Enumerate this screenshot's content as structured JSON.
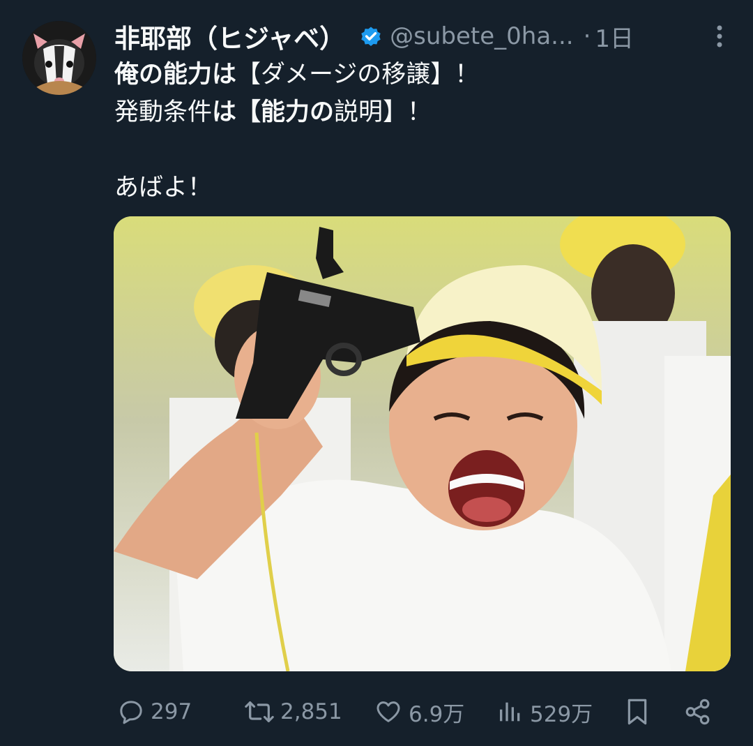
{
  "author": {
    "name": "非耶部（ヒジャベ）",
    "handle": "@subete_0ha...",
    "separator": "·",
    "time": "1日",
    "verified_color": "#1d9bf0"
  },
  "tweet": {
    "line1": {
      "bold_prefix": "俺の能力は",
      "rest": "【ダメージの移譲】！"
    },
    "line2": {
      "normal_1": "発動条件",
      "bold_1": "は【能力の",
      "normal_2": "説明",
      "rest": "】！"
    },
    "line3": "",
    "line4": "あばよ！"
  },
  "media": {
    "alt": "photo of a laughing child in a yellow cap pointing a starter pistol at his head"
  },
  "actions": {
    "replies": "297",
    "retweets": "2,851",
    "likes": "6.9万",
    "views": "529万"
  },
  "icons": {
    "reply": "reply-icon",
    "retweet": "retweet-icon",
    "like": "heart-icon",
    "views": "views-icon",
    "bookmark": "bookmark-icon",
    "share": "share-icon",
    "more": "more-icon"
  }
}
